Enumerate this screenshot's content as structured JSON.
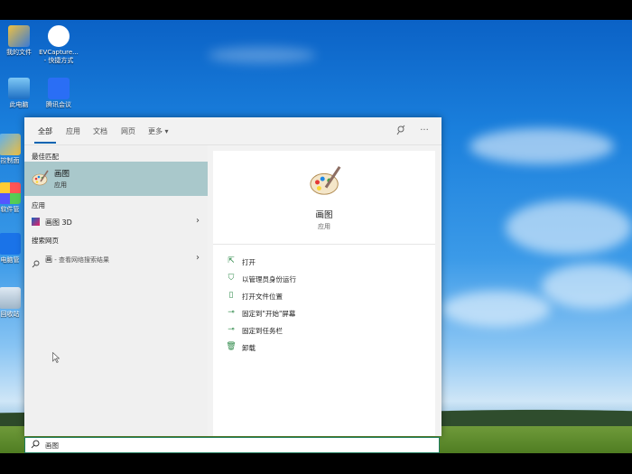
{
  "desktop": {
    "icons": [
      {
        "label": "我的文件",
        "icon": "documents-icon"
      },
      {
        "label": "EVCapture...",
        "label2": "- 快捷方式",
        "icon": "evcapture-icon"
      },
      {
        "label": "此电脑",
        "icon": "computer-icon"
      },
      {
        "label": "腾讯会议",
        "icon": "tencent-meeting-icon"
      },
      {
        "label": "控制面",
        "icon": "control-panel-icon"
      },
      {
        "label": "软件管",
        "icon": "software-manager-icon"
      },
      {
        "label": "电脑管",
        "icon": "pc-manager-icon"
      },
      {
        "label": "回收站",
        "icon": "recycle-bin-icon"
      }
    ]
  },
  "search": {
    "tabs": [
      {
        "label": "全部",
        "active": true
      },
      {
        "label": "应用"
      },
      {
        "label": "文档"
      },
      {
        "label": "网页"
      },
      {
        "label": "更多"
      }
    ],
    "more_caret": "▾",
    "feedback_icon": "feedback-icon",
    "options_icon": "more-options-icon",
    "sections": {
      "best_match": "最佳匹配",
      "apps": "应用",
      "web": "搜索网页"
    },
    "best_match": {
      "name": "画图",
      "type": "应用",
      "icon": "paint-icon"
    },
    "app_results": [
      {
        "name": "画图 3D",
        "icon": "paint3d-icon"
      }
    ],
    "web_results": [
      {
        "name": "画",
        "suffix": " - 查看网络搜索结果",
        "icon": "search-icon"
      }
    ],
    "preview": {
      "name": "画图",
      "type": "应用",
      "actions": [
        {
          "label": "打开",
          "icon": "open-icon"
        },
        {
          "label": "以管理员身份运行",
          "icon": "admin-shield-icon"
        },
        {
          "label": "打开文件位置",
          "icon": "file-location-icon"
        },
        {
          "label": "固定到\"开始\"屏幕",
          "icon": "pin-start-icon"
        },
        {
          "label": "固定到任务栏",
          "icon": "pin-taskbar-icon"
        },
        {
          "label": "卸载",
          "icon": "uninstall-icon"
        }
      ]
    },
    "query": "画图",
    "colors": {
      "accent": "#0063b1",
      "selected": "#a9c8cb",
      "action_icon": "#2f8a4a"
    }
  }
}
